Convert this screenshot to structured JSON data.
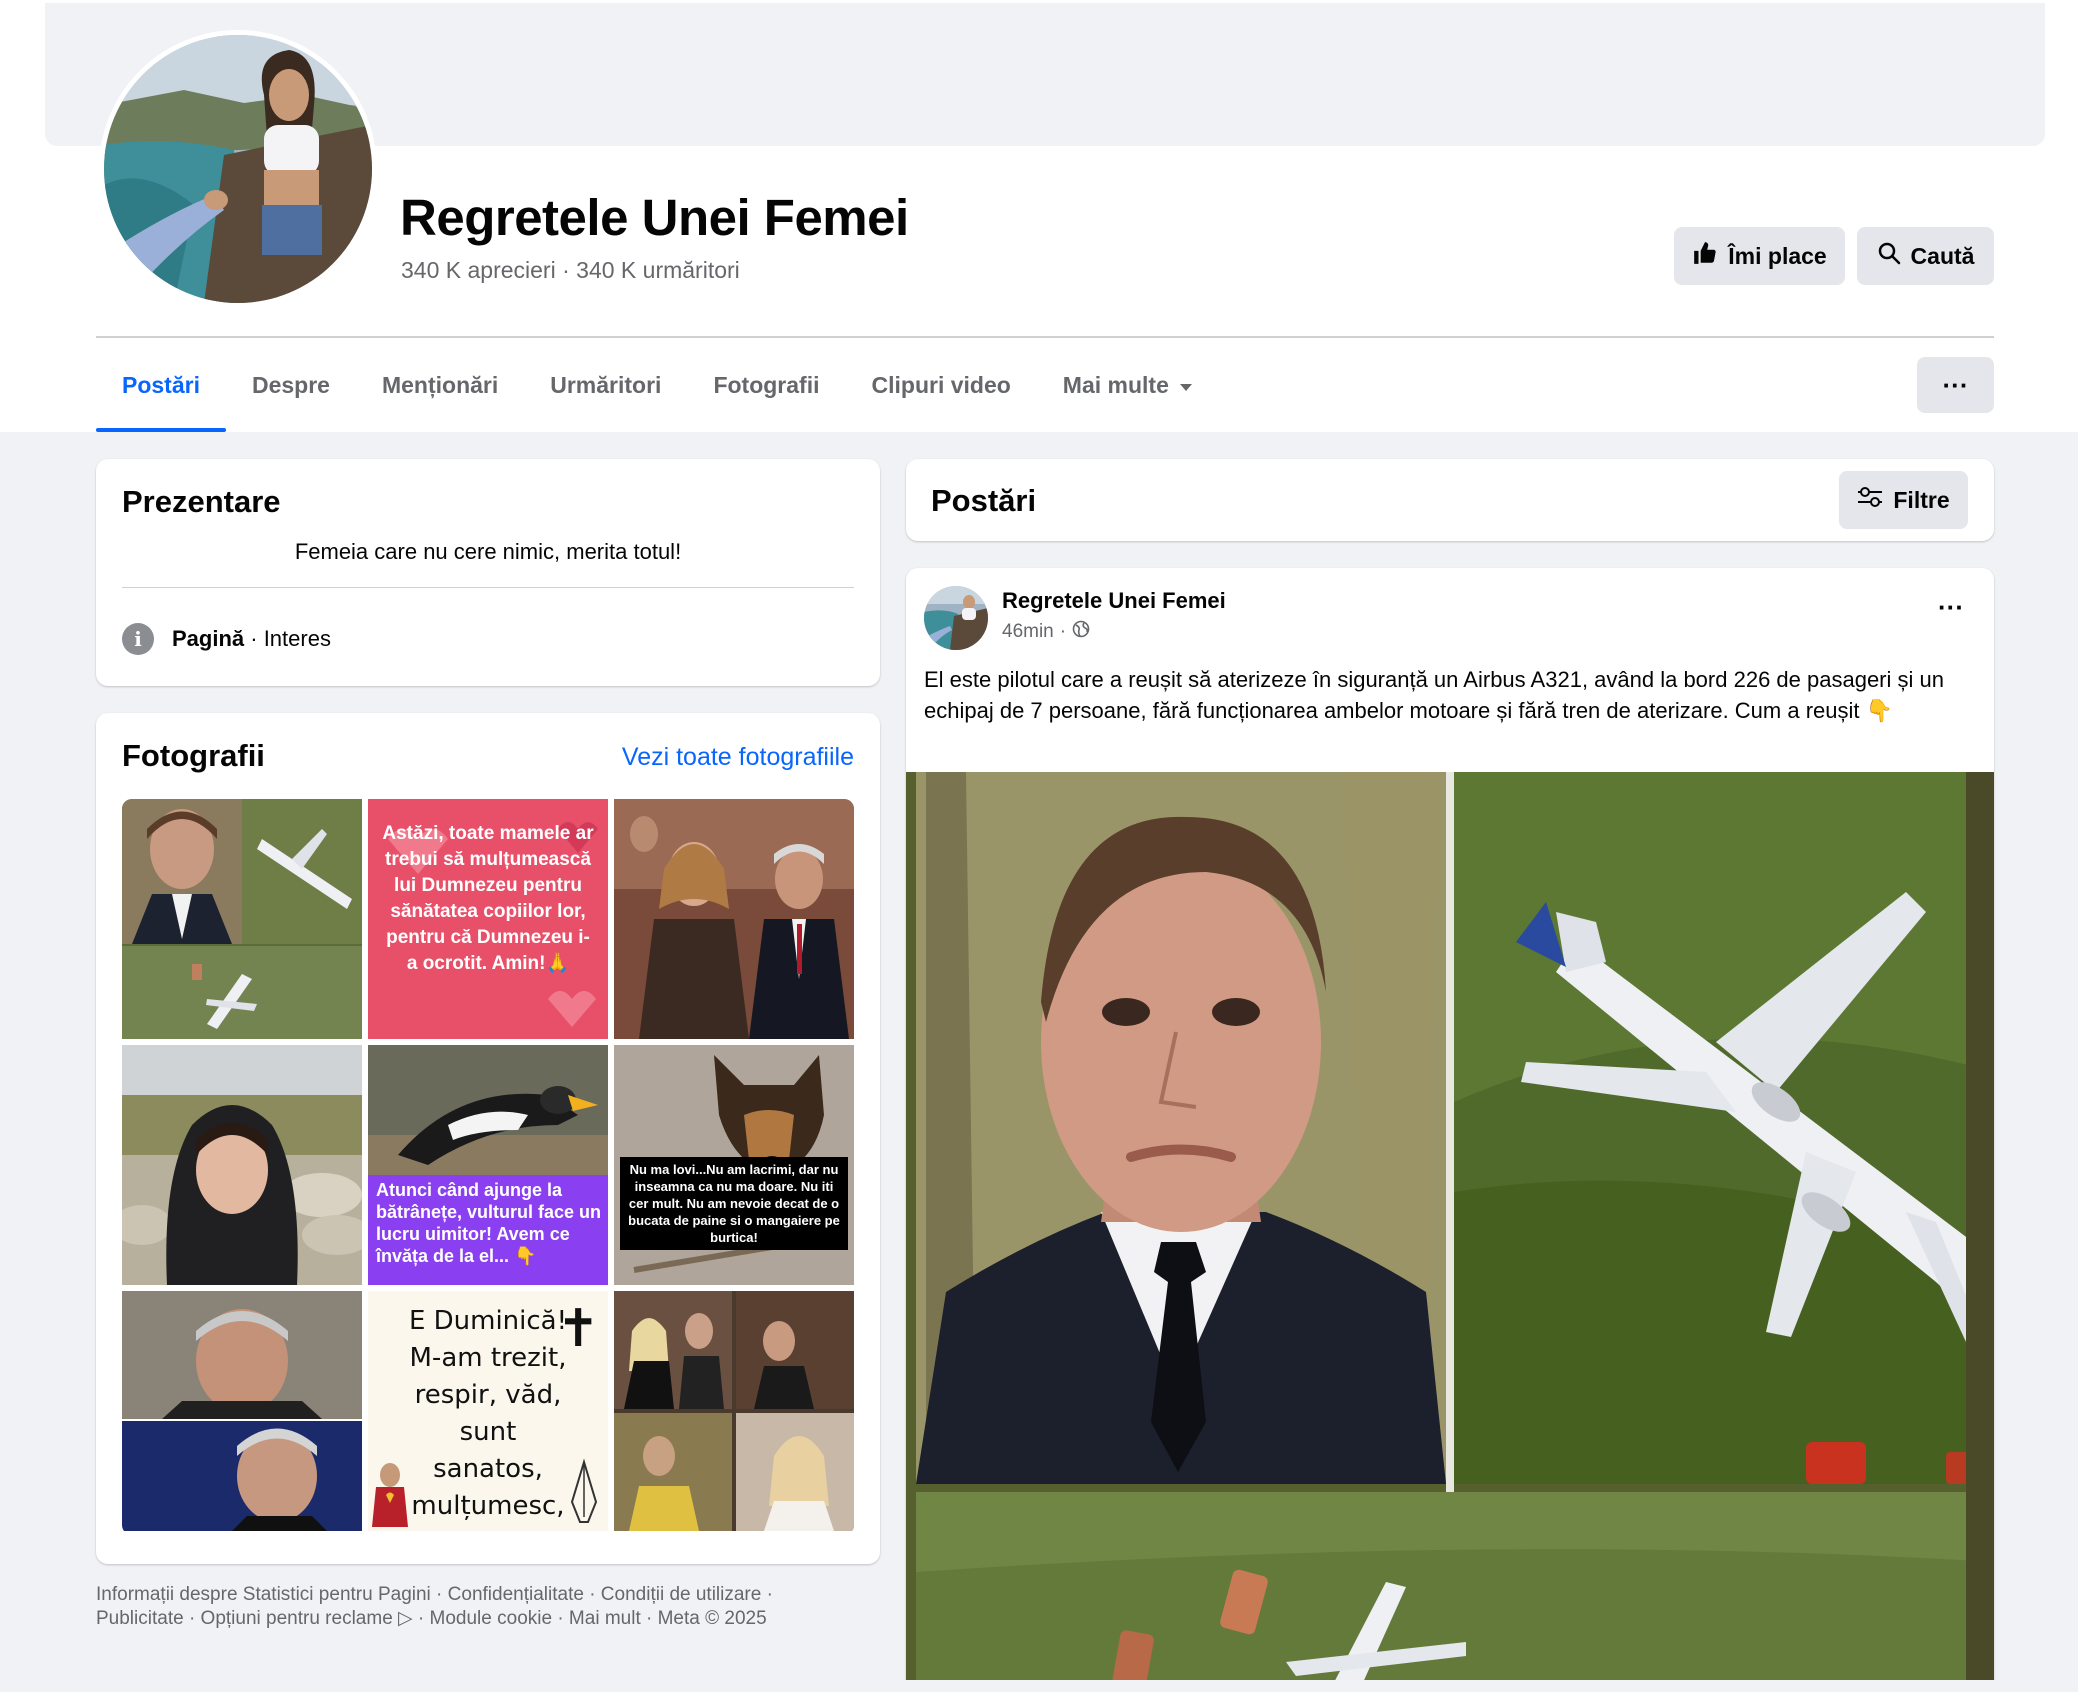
{
  "page": {
    "title": "Regretele Unei Femei",
    "likes": "340 K aprecieri",
    "separator": "·",
    "followers": "340 K urmăritori"
  },
  "actions": {
    "like_label": "Îmi place",
    "search_label": "Caută",
    "more_label": "···"
  },
  "tabs": [
    {
      "label": "Postări",
      "active": true
    },
    {
      "label": "Despre"
    },
    {
      "label": "Menționări"
    },
    {
      "label": "Urmăritori"
    },
    {
      "label": "Fotografii"
    },
    {
      "label": "Clipuri video"
    },
    {
      "label": "Mai multe"
    }
  ],
  "intro": {
    "title": "Prezentare",
    "bio": "Femeia care nu cere nimic, merita totul!",
    "category_bold": "Pagină",
    "category_rest": " · Interes",
    "info_icon": "i"
  },
  "photos": {
    "title": "Fotografii",
    "see_all": "Vezi toate fotografiile",
    "cells": [
      {
        "caption": ""
      },
      {
        "caption": "Astăzi, toate mamele ar trebui să mulțumească lui Dumnezeu pentru sănătatea copiilor lor, pentru că Dumnezeu i-a ocrotit. Amin!🙏"
      },
      {
        "caption": ""
      },
      {
        "caption": ""
      },
      {
        "caption": "Atunci când ajunge la bătrânețe, vulturul face un lucru uimitor! Avem ce învăța de la el... 👇"
      },
      {
        "caption": "Nu ma lovi...Nu am lacrimi, dar nu inseamna ca nu ma doare. Nu iti cer mult. Nu am nevoie decat de o bucata de paine si o mangaiere pe burtica!"
      },
      {
        "caption": ""
      },
      {
        "caption": "E Duminică! M-am trezit, respir, văd, sunt sanatos, mulțumesc, Doamne!",
        "cross": "✝"
      },
      {
        "caption": ""
      }
    ]
  },
  "footer": {
    "line1": "Informații despre Statistici pentru Pagini · Confidențialitate · Condiții de utilizare ·",
    "line2": "Publicitate · Opțiuni pentru reclame ▷ · Module cookie · Mai mult · Meta © 2025"
  },
  "posts": {
    "title": "Postări",
    "filter_label": "Filtre",
    "post": {
      "author": "Regretele Unei Femei",
      "time": "46min",
      "dot": "·",
      "text": "El este pilotul care a reușit să aterizeze în siguranță un Airbus A321, având la bord 226 de pasageri și un echipaj de 7 persoane, fără funcționarea ambelor motoare și fără tren de aterizare. Cum a reușit 👇",
      "menu": "···"
    }
  },
  "colors": {
    "accent": "#0866ff",
    "background": "#f0f2f5",
    "button": "#e4e6eb",
    "secondary_text": "#65676b"
  }
}
